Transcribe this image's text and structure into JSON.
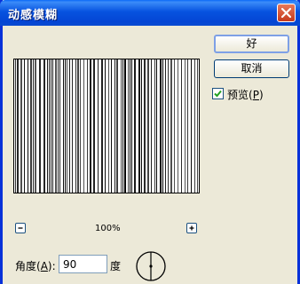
{
  "window": {
    "title": "动感模糊"
  },
  "buttons": {
    "ok_label": "好",
    "cancel_label": "取消"
  },
  "preview_option": {
    "label_prefix": "预览(",
    "mnemonic": "P",
    "label_suffix": ")",
    "checked": true
  },
  "zoom": {
    "level": "100%"
  },
  "angle": {
    "label_prefix": "角度(",
    "mnemonic": "A",
    "label_suffix": "):",
    "value": "90",
    "unit": "度"
  },
  "colors": {
    "title_bar": "#0553e0",
    "dialog_bg": "#ece9d8",
    "close_button": "#c5391c",
    "check_mark": "#21a121"
  },
  "icons": {
    "close": "close-icon",
    "zoom_out": "minus-icon",
    "zoom_in": "plus-icon",
    "check": "checkmark-icon",
    "dial": "angle-dial-icon"
  }
}
